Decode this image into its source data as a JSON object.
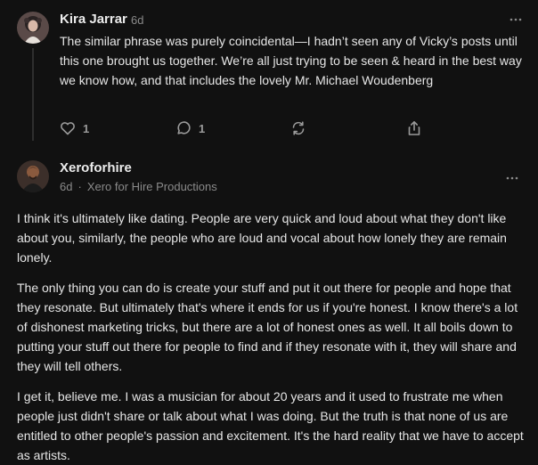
{
  "comments": [
    {
      "author": "Kira Jarrar",
      "time": "6d",
      "paragraphs": [
        "The similar phrase was purely coincidental—I hadn’t seen any of Vicky’s posts until this one brought us together. We’re all just trying to be seen & heard in the best way we know how, and that includes the lovely Mr. Michael Woudenberg"
      ],
      "likes": "1",
      "replies": "1"
    },
    {
      "author": "Xeroforhire",
      "time": "6d",
      "separator": "·",
      "publication": "Xero for Hire Productions",
      "paragraphs": [
        "I think it's ultimately like dating. People are very quick and loud about what they don't like about you, similarly, the people who are loud and vocal about how lonely they are remain lonely.",
        "The only thing you can do is create your stuff and put it out there for people and hope that they resonate. But ultimately that's where it ends for us if you're honest. I know there's a lot of dishonest marketing tricks, but there are a lot of honest ones as well. It all boils down to putting your stuff out there for people to find and if they resonate with it, they will share and they will tell others.",
        "I get it, believe me. I was a musician for about 20 years and it used to frustrate me when people just didn't share or talk about what I was doing. But the truth is that none of us are entitled to other people's passion and excitement. It's the hard reality that we have to accept as artists."
      ]
    }
  ],
  "icons": {
    "like": "heart-icon",
    "reply": "speech-bubble-icon",
    "restack": "restack-icon",
    "share": "share-icon",
    "more": "more-dots-icon"
  },
  "colors": {
    "background": "#111111",
    "text": "#e6e6e6",
    "muted": "#8a8a8a",
    "icon": "#9a9a9a"
  }
}
